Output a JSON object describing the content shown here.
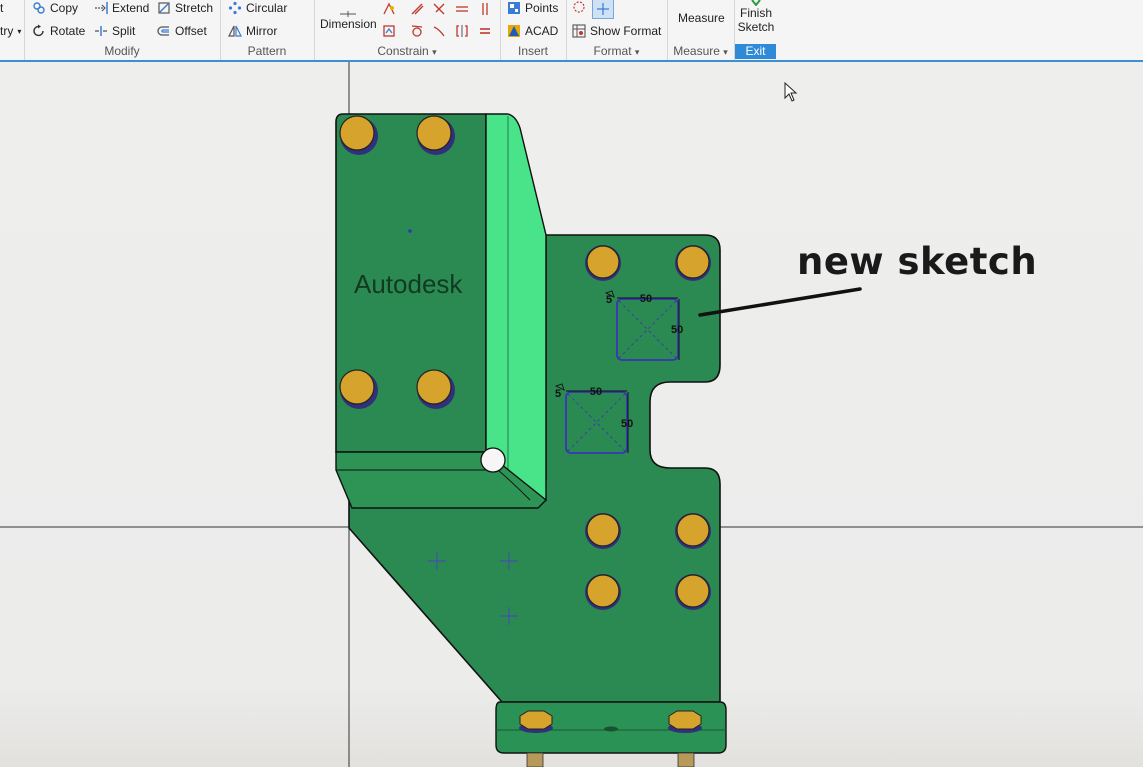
{
  "ribbon": {
    "cut_items": [
      "t",
      "try"
    ],
    "modify": {
      "label": "Modify",
      "copy": "Copy",
      "extend": "Extend",
      "stretch": "Stretch",
      "rotate": "Rotate",
      "split": "Split",
      "offset": "Offset"
    },
    "pattern": {
      "label": "Pattern",
      "circular": "Circular",
      "mirror": "Mirror"
    },
    "constrain": {
      "label": "Constrain",
      "dimension": "Dimension"
    },
    "insert": {
      "label": "Insert",
      "points": "Points",
      "acad": "ACAD"
    },
    "format": {
      "label": "Format",
      "show_format": "Show Format"
    },
    "measure": {
      "label": "Measure",
      "measure": "Measure"
    },
    "exit": {
      "finish_line1": "Finish",
      "finish_line2": "Sketch",
      "label": "Exit"
    }
  },
  "model": {
    "brand_text": "Autodesk",
    "annotation": "new sketch",
    "dims": {
      "top_width": "50",
      "top_height": "50",
      "top_chamfer": "5",
      "bottom_width": "50",
      "bottom_height": "50",
      "bottom_chamfer": "5"
    }
  },
  "colors": {
    "part_green": "#2d8f57",
    "part_light_green": "#49e38a",
    "bolt_gold": "#d6a32c",
    "sketch_blue": "#3a33b8",
    "ribbon_accent": "#2f8bd8"
  }
}
